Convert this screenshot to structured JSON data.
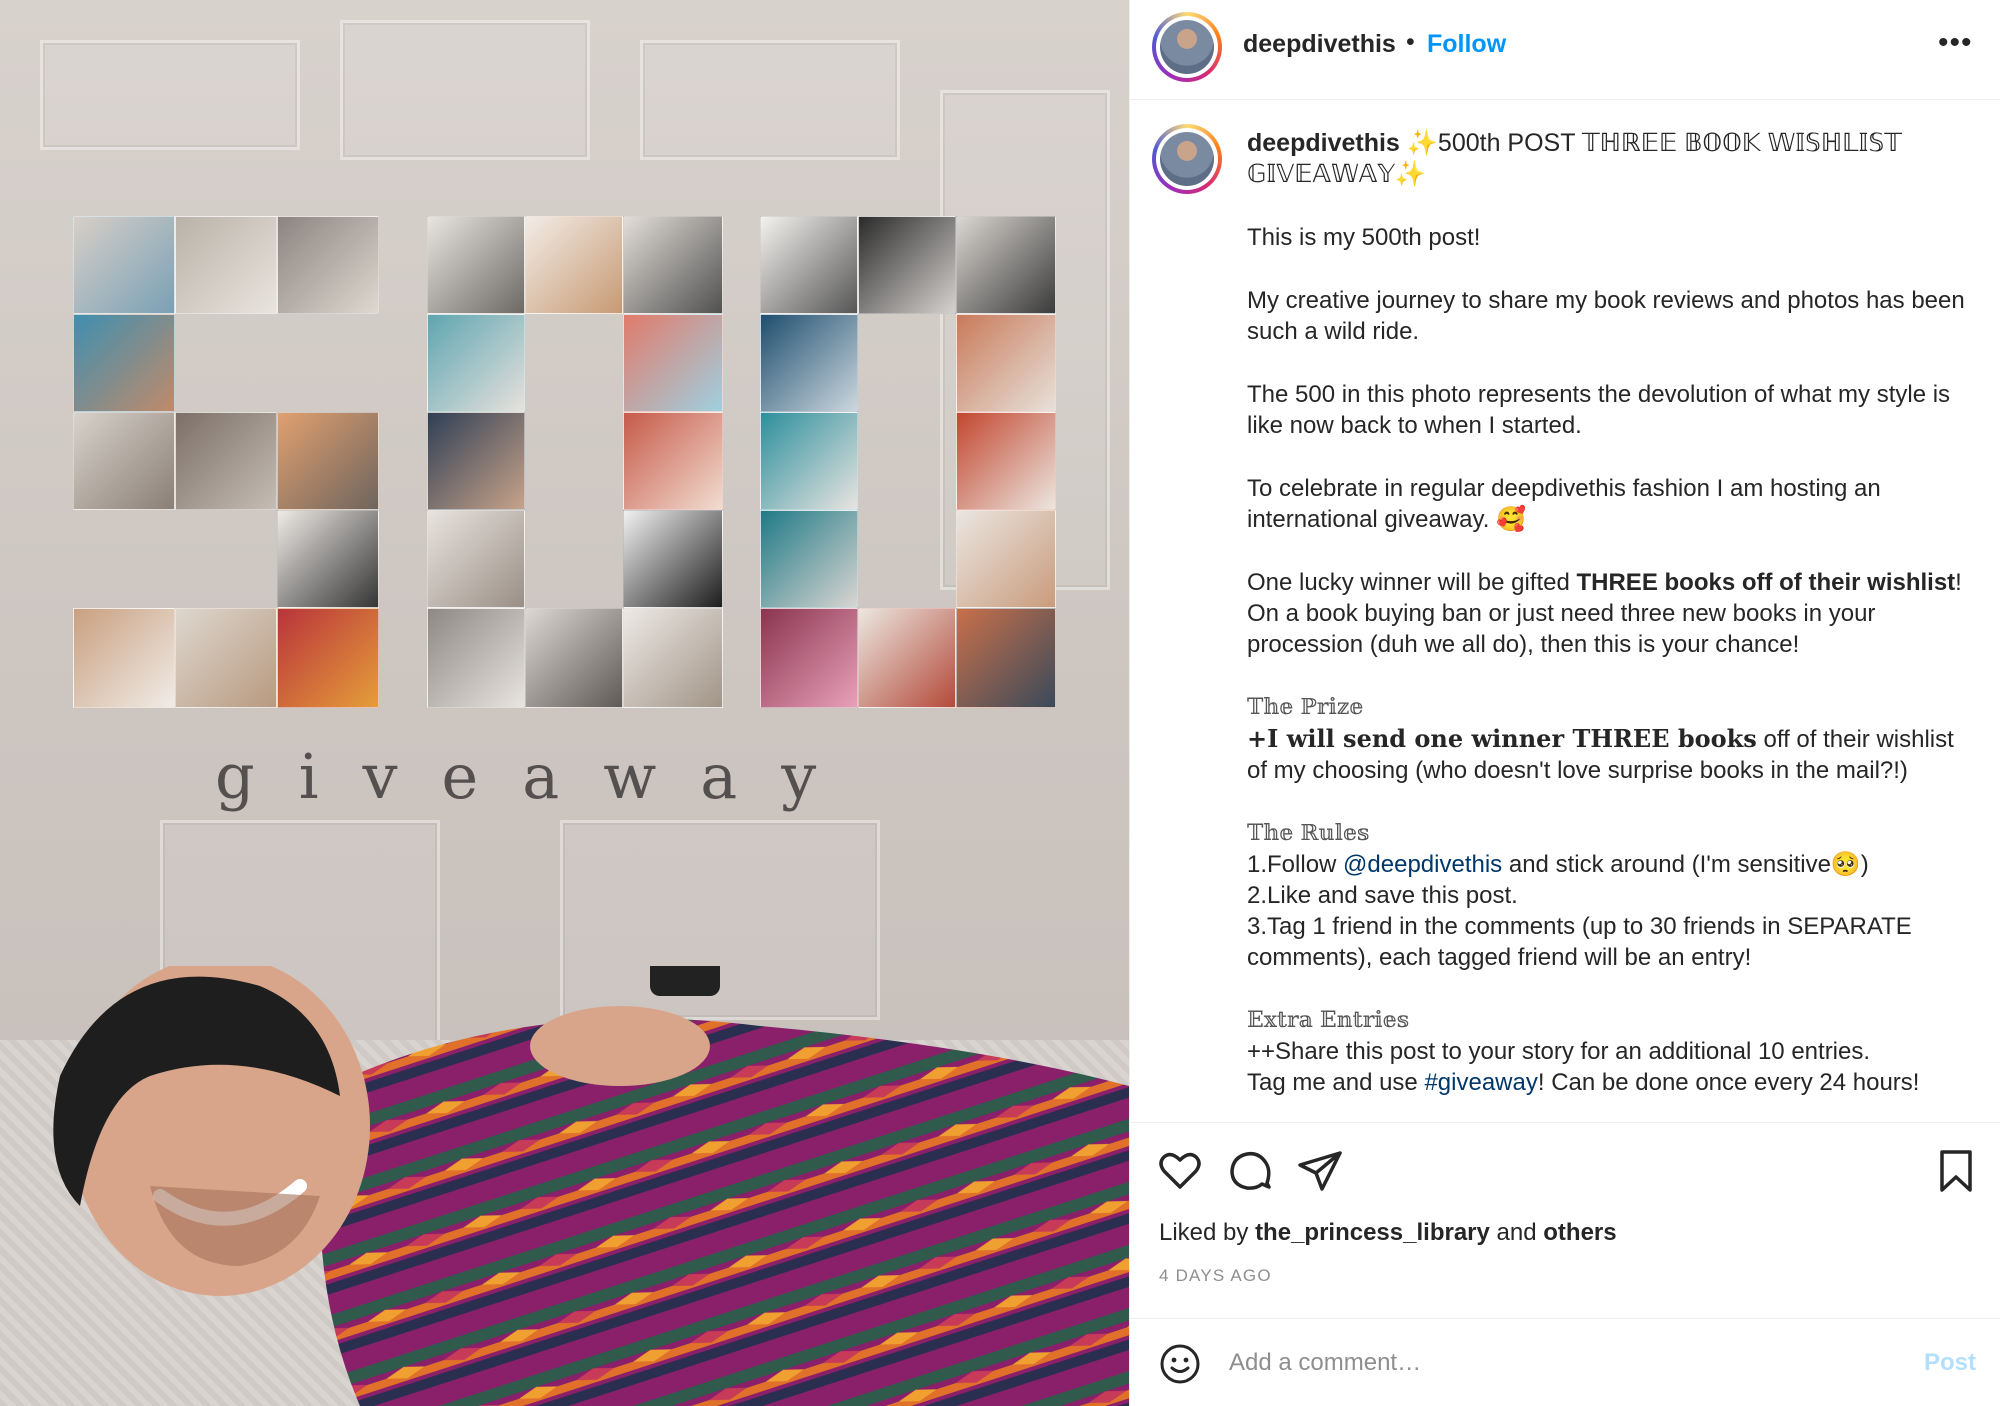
{
  "header": {
    "username": "deepdivethis",
    "separator": "•",
    "follow_label": "Follow",
    "more_icon": "more-horizontal-icon",
    "more_label": "•••"
  },
  "photo": {
    "overlay_word": "giveaway"
  },
  "caption": {
    "username": "deepdivethis",
    "title_rest": "✨500th POST 𝕋ℍℝ𝔼𝔼 𝔹𝕆𝕆𝕂 𝕎𝕀𝕊ℍ𝕃𝕀𝕊𝕋 𝔾𝕀𝕍𝔼𝔸𝕎𝔸𝕐✨",
    "p1": "This is my 500th post!",
    "p2": "My creative journey to share my book reviews and photos has been such a wild ride.",
    "p3": "The 500 in this photo represents the devolution of what my style is like now back to when I started.",
    "p4": "To celebrate in regular deepdivethis fashion I am hosting an international giveaway. 🥰",
    "p5_a": "One lucky winner will be gifted ",
    "p5_bold": "THREE books off of their wishlist",
    "p5_b": "! On a book buying ban or just need three new books in your procession (duh we all do), then this is your chance!",
    "prize_head": "𝕋𝕙𝕖 ℙ𝕣𝕚𝕫𝕖",
    "prize_bold": "+I will send one winner THREE books",
    "prize_rest": " off of their wishlist of my choosing (who doesn't love surprise books in the mail?!)",
    "rules_head": "𝕋𝕙𝕖 ℝ𝕦𝕝𝕖𝕤",
    "rule1_a": "1.Follow ",
    "rule1_link": "@deepdivethis",
    "rule1_b": " and stick around (I'm sensitive🥺)",
    "rule2": "2.Like and save this post.",
    "rule3": "3.Tag 1 friend in the comments (up to 30 friends in SEPARATE comments), each tagged friend will be an entry!",
    "extra_head": "𝔼𝕩𝕥𝕣𝕒 𝔼𝕟𝕥𝕣𝕚𝕖𝕤",
    "extra1": "++Share this post to your story for an additional 10 entries.",
    "extra2_a": "Tag me and use ",
    "extra2_link": "#giveaway",
    "extra2_b": "! Can be done once every 24 hours!"
  },
  "actions": {
    "like_icon": "heart-icon",
    "comment_icon": "comment-icon",
    "share_icon": "send-icon",
    "save_icon": "bookmark-icon",
    "liked_prefix": "Liked by ",
    "liked_user": "the_princess_library",
    "liked_mid": " and ",
    "liked_others": "others",
    "time_ago": "4 DAYS AGO"
  },
  "comment": {
    "emoji_icon": "smiley-icon",
    "placeholder": "Add a comment…",
    "post_label": "Post"
  },
  "colors": {
    "accent": "#0095f6",
    "post_disabled": "#b2dffc",
    "link": "#00376b",
    "muted": "#8e8e8e"
  }
}
